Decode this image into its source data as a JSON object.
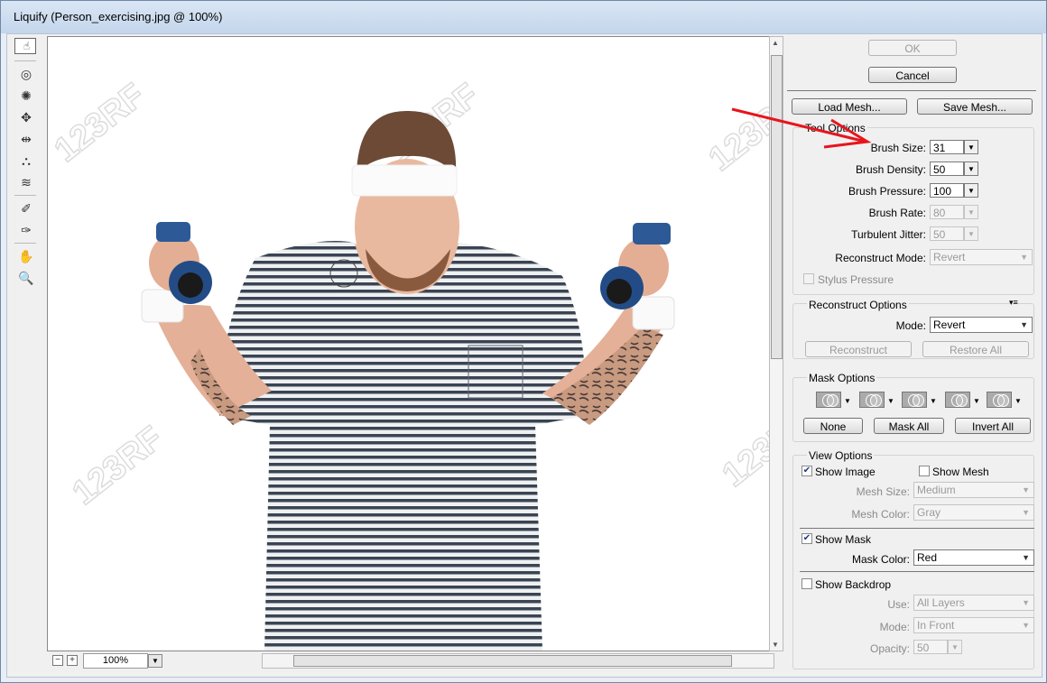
{
  "window": {
    "title": "Liquify (Person_exercising.jpg @ 100%)"
  },
  "canvas": {
    "zoom": "100%",
    "watermark": "123RF",
    "image_alt": "Person exercising with dumbbells"
  },
  "buttons": {
    "ok": "OK",
    "cancel": "Cancel",
    "load_mesh": "Load Mesh...",
    "save_mesh": "Save Mesh..."
  },
  "tool_options": {
    "title": "Tool Options",
    "brush_size": {
      "label": "Brush Size:",
      "value": "31"
    },
    "brush_density": {
      "label": "Brush Density:",
      "value": "50"
    },
    "brush_pressure": {
      "label": "Brush Pressure:",
      "value": "100"
    },
    "brush_rate": {
      "label": "Brush Rate:",
      "value": "80"
    },
    "turbulent_jitter": {
      "label": "Turbulent Jitter:",
      "value": "50"
    },
    "reconstruct_mode": {
      "label": "Reconstruct Mode:",
      "value": "Revert"
    },
    "stylus_pressure": "Stylus Pressure"
  },
  "reconstruct_options": {
    "title": "Reconstruct Options",
    "mode_label": "Mode:",
    "mode_value": "Revert",
    "reconstruct": "Reconstruct",
    "restore_all": "Restore All"
  },
  "mask_options": {
    "title": "Mask Options",
    "none": "None",
    "mask_all": "Mask All",
    "invert_all": "Invert All"
  },
  "view_options": {
    "title": "View Options",
    "show_image": "Show Image",
    "show_mesh": "Show Mesh",
    "mesh_size": {
      "label": "Mesh Size:",
      "value": "Medium"
    },
    "mesh_color": {
      "label": "Mesh Color:",
      "value": "Gray"
    },
    "show_mask": "Show Mask",
    "mask_color": {
      "label": "Mask Color:",
      "value": "Red"
    },
    "show_backdrop": "Show Backdrop",
    "use": {
      "label": "Use:",
      "value": "All Layers"
    },
    "mode": {
      "label": "Mode:",
      "value": "In Front"
    },
    "opacity": {
      "label": "Opacity:",
      "value": "50"
    }
  },
  "colors": {
    "annotation_arrow": "#e8141c",
    "title_bar": "#c4d6ec"
  }
}
